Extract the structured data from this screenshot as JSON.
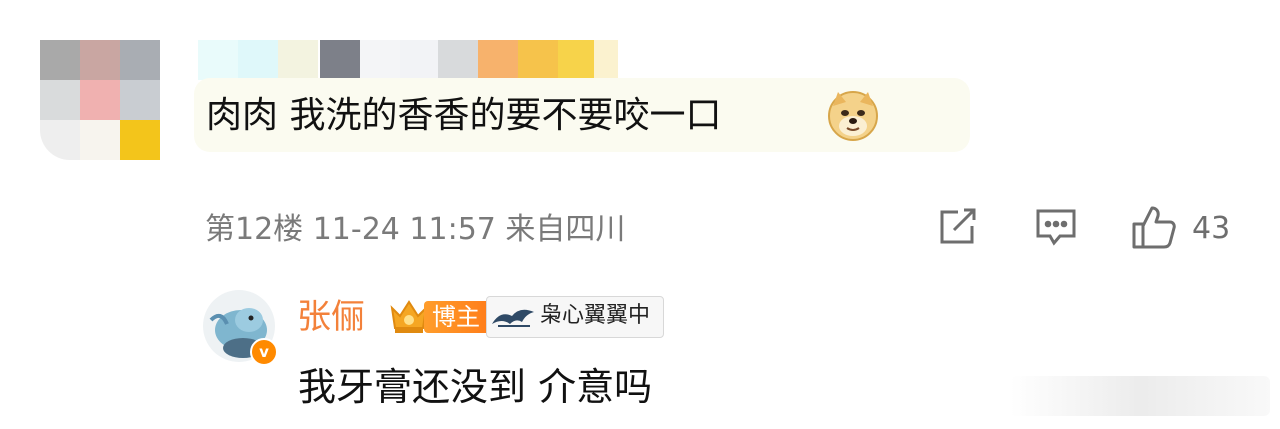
{
  "comment": {
    "text": "肉肉 我洗的香香的要不要咬一口",
    "emoji_icon": "doge-emoji-icon",
    "meta": "第12楼 11-24 11:57 来自四川",
    "like_count": "43"
  },
  "reply": {
    "username": "张俪",
    "host_tag": "博主",
    "fan_badge": "枭心翼翼中",
    "text": "我牙膏还没到 介意吗",
    "verified_badge": "v"
  },
  "colors": {
    "username": "#f3813a",
    "host_tag": "#ff8a22",
    "meta": "#7a7a7a",
    "icon": "#6e6e6e"
  }
}
